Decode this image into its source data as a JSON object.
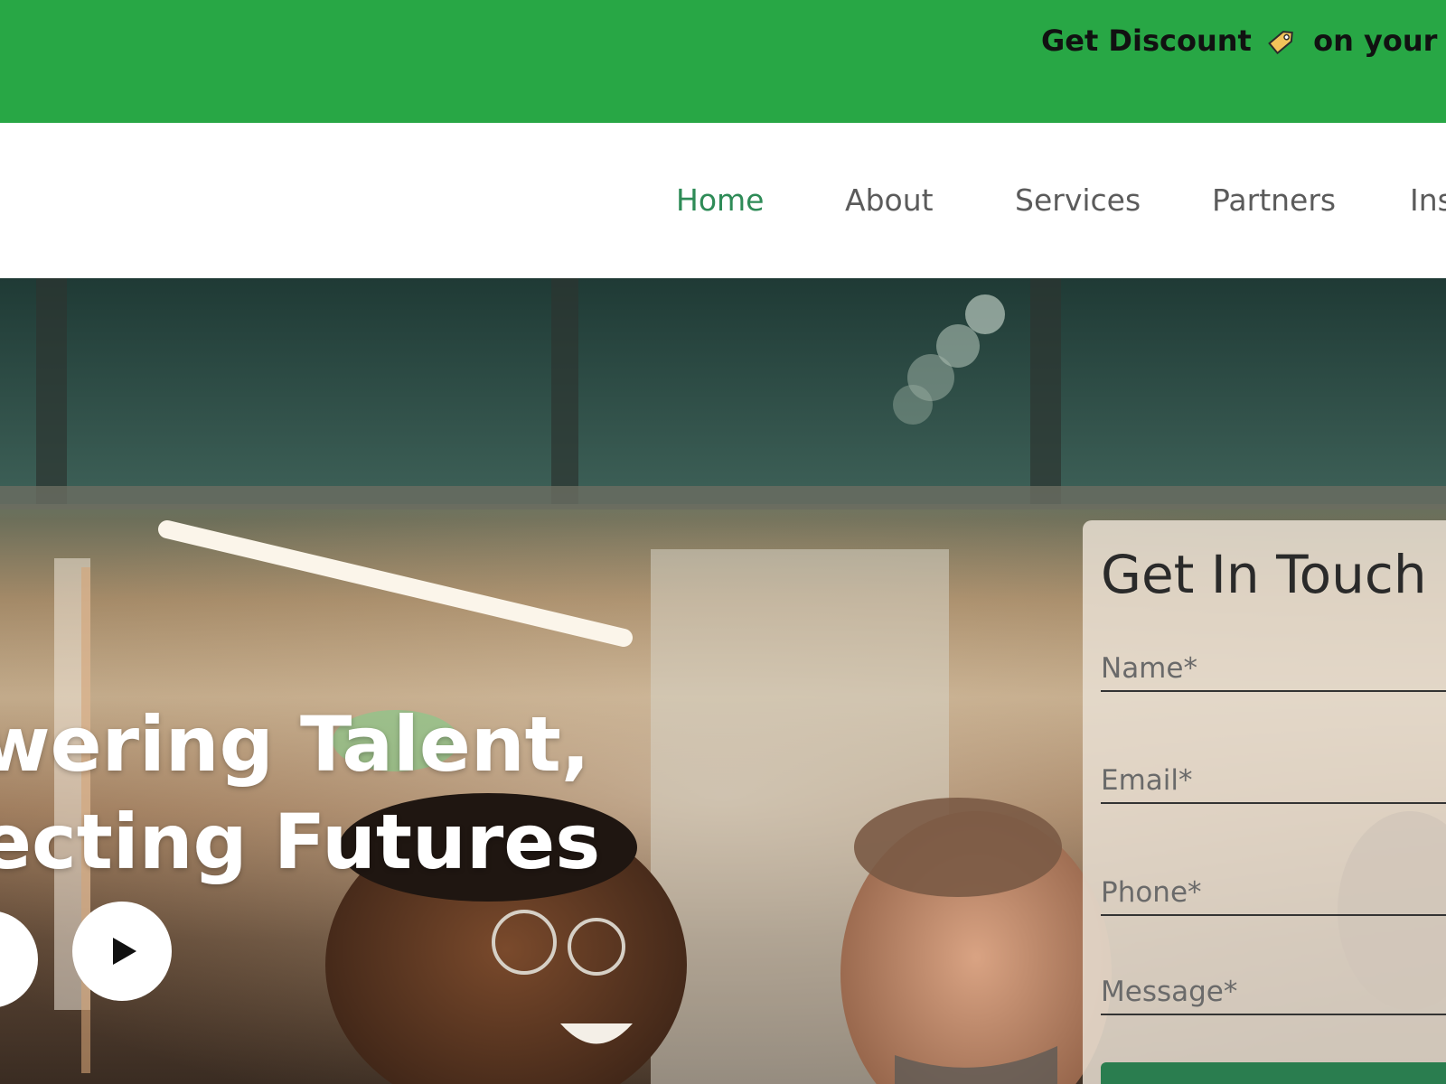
{
  "promo": {
    "text_before": "Get Discount",
    "icon": "tag-icon",
    "text_after": "on your fi"
  },
  "nav": {
    "items": [
      {
        "label": "Home",
        "active": true
      },
      {
        "label": "About",
        "active": false
      },
      {
        "label": "Services",
        "active": false
      },
      {
        "label": "Partners",
        "active": false
      },
      {
        "label": "Ins",
        "active": false
      }
    ]
  },
  "hero": {
    "title_line1": "wering Talent,",
    "title_line2": "ecting Futures",
    "play_icon": "play-icon"
  },
  "contact": {
    "title": "Get In Touch",
    "fields": {
      "name_placeholder": "Name*",
      "email_placeholder": "Email*",
      "phone_placeholder": "Phone*",
      "message_placeholder": "Message*"
    }
  },
  "colors": {
    "banner_green": "#28a745",
    "nav_active": "#2e8b57",
    "submit_green": "#2a7d4f"
  }
}
